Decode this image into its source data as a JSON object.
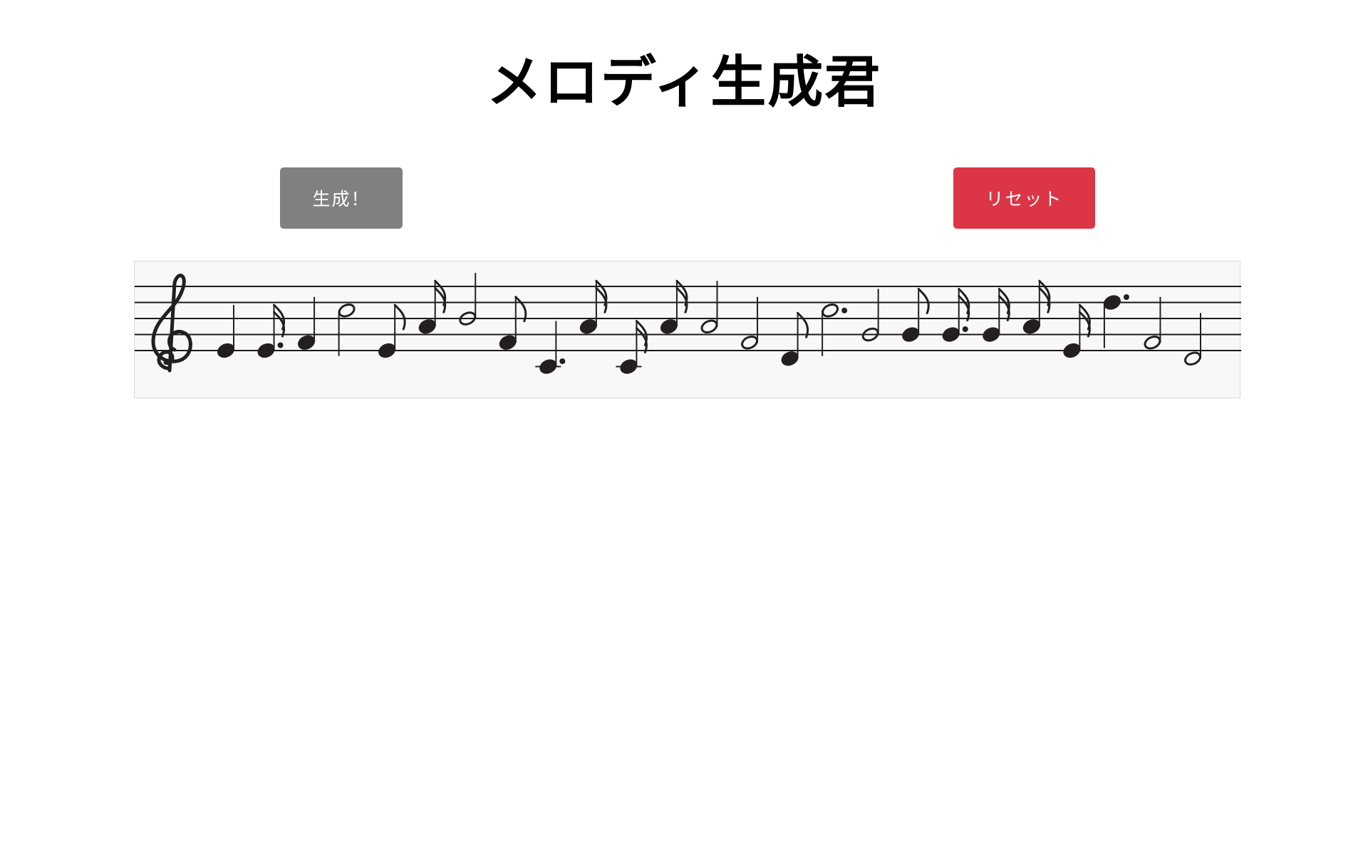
{
  "page": {
    "title": "メロディ生成君"
  },
  "controls": {
    "generate_label": "生成！",
    "reset_label": "リセット"
  },
  "colors": {
    "generate_button": "#808080",
    "reset_button": "#dc3545",
    "note_ink": "#231f20",
    "staff_line": "#1a1a1a",
    "score_background": "#f8f8f8"
  },
  "score": {
    "clef": "treble-clef",
    "notes": [
      {
        "pitch": "E4",
        "duration": "quarter"
      },
      {
        "pitch": "E4",
        "duration": "dotted-sixteenth"
      },
      {
        "pitch": "F4",
        "duration": "quarter"
      },
      {
        "pitch": "C5",
        "duration": "half"
      },
      {
        "pitch": "E4",
        "duration": "eighth"
      },
      {
        "pitch": "A4",
        "duration": "sixteenth"
      },
      {
        "pitch": "B4",
        "duration": "half"
      },
      {
        "pitch": "F4",
        "duration": "eighth"
      },
      {
        "pitch": "C4",
        "duration": "dotted-quarter"
      },
      {
        "pitch": "A4",
        "duration": "sixteenth"
      },
      {
        "pitch": "C4",
        "duration": "sixteenth"
      },
      {
        "pitch": "A4",
        "duration": "sixteenth"
      },
      {
        "pitch": "A4",
        "duration": "half"
      },
      {
        "pitch": "F4",
        "duration": "half"
      },
      {
        "pitch": "D4",
        "duration": "eighth"
      },
      {
        "pitch": "C5",
        "duration": "dotted-half"
      },
      {
        "pitch": "G4",
        "duration": "half"
      },
      {
        "pitch": "G4",
        "duration": "eighth"
      },
      {
        "pitch": "G4",
        "duration": "dotted-sixteenth"
      },
      {
        "pitch": "G4",
        "duration": "sixteenth"
      },
      {
        "pitch": "A4",
        "duration": "sixteenth"
      },
      {
        "pitch": "E4",
        "duration": "sixteenth"
      },
      {
        "pitch": "D5",
        "duration": "dotted-quarter"
      },
      {
        "pitch": "F4",
        "duration": "half"
      },
      {
        "pitch": "D4",
        "duration": "half"
      }
    ]
  }
}
